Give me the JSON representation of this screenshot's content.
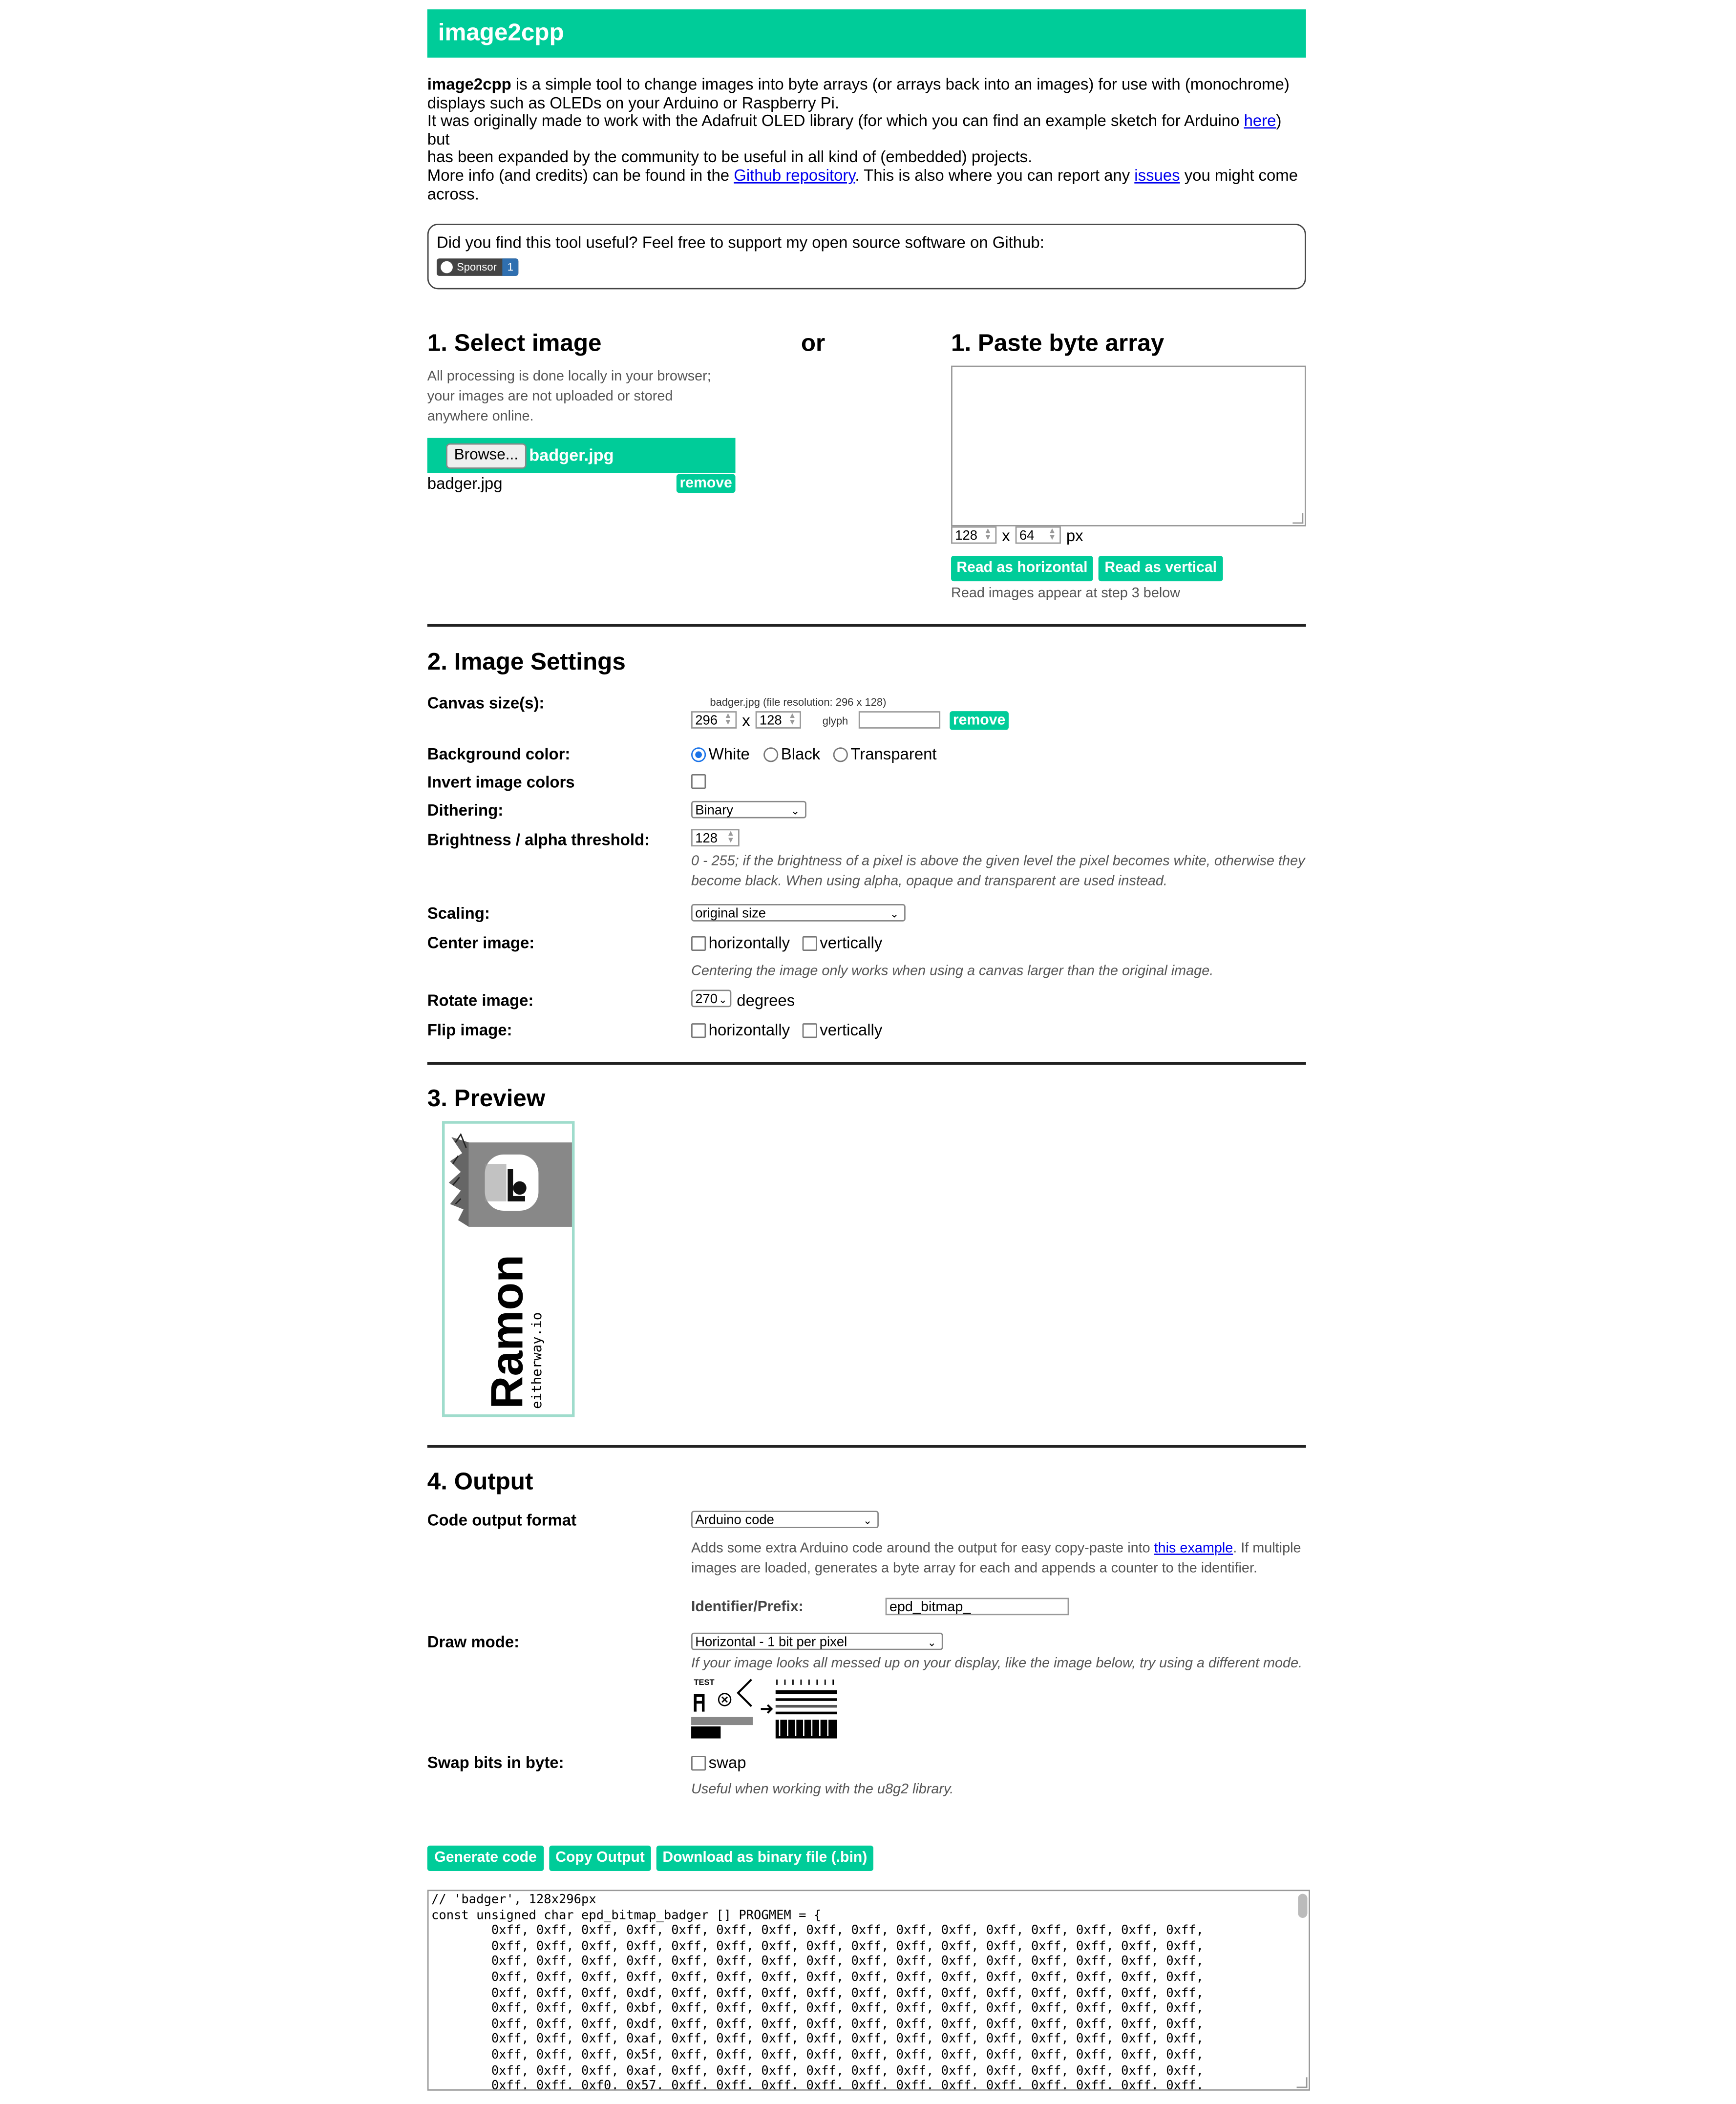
{
  "header": {
    "title": "image2cpp"
  },
  "intro": {
    "bold_name": "image2cpp",
    "line1": " is a simple tool to change images into byte arrays (or arrays back into an images) for use with (monochrome)",
    "line2": "displays such as OLEDs on your Arduino or Raspberry Pi.",
    "line3a": "It was originally made to work with the Adafruit OLED library (for which you can find an example sketch for Arduino ",
    "line3_link": "here",
    "line3b": ") but",
    "line4": "has been expanded by the community to be useful in all kind of (embedded) projects.",
    "more_a": "More info (and credits) can be found in the ",
    "more_link1": "Github repository",
    "more_b": ". This is also where you can report any ",
    "more_link2": "issues",
    "more_c": " you might come",
    "more_d": "across."
  },
  "sponsor": {
    "text": "Did you find this tool useful? Feel free to support my open source software on Github:",
    "button": "Sponsor",
    "count": "1"
  },
  "step1": {
    "select_title": "1. Select image",
    "or": "or",
    "paste_title": "1. Paste byte array",
    "note_lines": [
      "All processing is done locally in your browser;",
      "your images are not uploaded or stored",
      "anywhere online."
    ],
    "browse_label": "Browse...",
    "selected_file": "badger.jpg",
    "file_list_name": "badger.jpg",
    "remove": "remove",
    "width": "128",
    "x": "x",
    "height": "64",
    "px": "px",
    "read_horizontal": "Read as horizontal",
    "read_vertical": "Read as vertical",
    "read_note": "Read images appear at step 3 below"
  },
  "step2": {
    "title": "2. Image Settings",
    "canvas_label": "Canvas size(s):",
    "canvas_file_note": "badger.jpg (file resolution: 296 x 128)",
    "canvas_w": "296",
    "canvas_x": "x",
    "canvas_h": "128",
    "glyph_label": "glyph",
    "remove": "remove",
    "bg_label": "Background color:",
    "bg_options": [
      "White",
      "Black",
      "Transparent"
    ],
    "invert_label": "Invert image colors",
    "dither_label": "Dithering:",
    "dither_value": "Binary",
    "threshold_label": "Brightness / alpha threshold:",
    "threshold_value": "128",
    "threshold_help1": "0 - 255; if the brightness of a pixel is above the given level the pixel becomes white, otherwise they",
    "threshold_help2": "become black. When using alpha, opaque and transparent are used instead.",
    "scaling_label": "Scaling:",
    "scaling_value": "original size",
    "center_label": "Center image:",
    "horizontally": "horizontally",
    "vertically": "vertically",
    "center_help": "Centering the image only works when using a canvas larger than the original image.",
    "rotate_label": "Rotate image:",
    "rotate_value": "270",
    "degrees": "degrees",
    "flip_label": "Flip image:"
  },
  "step3": {
    "title": "3. Preview",
    "preview_big": "Ramon",
    "preview_small": "eitherway.io"
  },
  "step4": {
    "title": "4. Output",
    "format_label": "Code output format",
    "format_value": "Arduino code",
    "format_help1a": "Adds some extra Arduino code around the output for easy copy-paste into ",
    "format_help1_link": "this example",
    "format_help1b": ". If multiple",
    "format_help2": "images are loaded, generates a byte array for each and appends a counter to the identifier.",
    "identifier_label": "Identifier/Prefix:",
    "identifier_value": "epd_bitmap_",
    "draw_label": "Draw mode:",
    "draw_value": "Horizontal - 1 bit per pixel",
    "draw_help": "If your image looks all messed up on your display, like the image below, try using a different mode.",
    "sample_test": "TEST",
    "swap_label": "Swap bits in byte:",
    "swap_check": "swap",
    "swap_help": "Useful when working with the u8g2 library.",
    "generate": "Generate code",
    "copy": "Copy Output",
    "download": "Download as binary file (.bin)"
  },
  "code_lines": [
    "// 'badger', 128x296px",
    "const unsigned char epd_bitmap_badger [] PROGMEM = {",
    "\t0xff, 0xff, 0xff, 0xff, 0xff, 0xff, 0xff, 0xff, 0xff, 0xff, 0xff, 0xff, 0xff, 0xff, 0xff, 0xff,",
    "\t0xff, 0xff, 0xff, 0xff, 0xff, 0xff, 0xff, 0xff, 0xff, 0xff, 0xff, 0xff, 0xff, 0xff, 0xff, 0xff,",
    "\t0xff, 0xff, 0xff, 0xff, 0xff, 0xff, 0xff, 0xff, 0xff, 0xff, 0xff, 0xff, 0xff, 0xff, 0xff, 0xff,",
    "\t0xff, 0xff, 0xff, 0xff, 0xff, 0xff, 0xff, 0xff, 0xff, 0xff, 0xff, 0xff, 0xff, 0xff, 0xff, 0xff,",
    "\t0xff, 0xff, 0xff, 0xdf, 0xff, 0xff, 0xff, 0xff, 0xff, 0xff, 0xff, 0xff, 0xff, 0xff, 0xff, 0xff,",
    "\t0xff, 0xff, 0xff, 0xbf, 0xff, 0xff, 0xff, 0xff, 0xff, 0xff, 0xff, 0xff, 0xff, 0xff, 0xff, 0xff,",
    "\t0xff, 0xff, 0xff, 0xdf, 0xff, 0xff, 0xff, 0xff, 0xff, 0xff, 0xff, 0xff, 0xff, 0xff, 0xff, 0xff,",
    "\t0xff, 0xff, 0xff, 0xaf, 0xff, 0xff, 0xff, 0xff, 0xff, 0xff, 0xff, 0xff, 0xff, 0xff, 0xff, 0xff,",
    "\t0xff, 0xff, 0xff, 0x5f, 0xff, 0xff, 0xff, 0xff, 0xff, 0xff, 0xff, 0xff, 0xff, 0xff, 0xff, 0xff,",
    "\t0xff, 0xff, 0xff, 0xaf, 0xff, 0xff, 0xff, 0xff, 0xff, 0xff, 0xff, 0xff, 0xff, 0xff, 0xff, 0xff,",
    "\t0xff, 0xff, 0xf0, 0x57, 0xff, 0xff, 0xff, 0xff, 0xff, 0xff, 0xff, 0xff, 0xff, 0xff, 0xff, 0xff,"
  ]
}
